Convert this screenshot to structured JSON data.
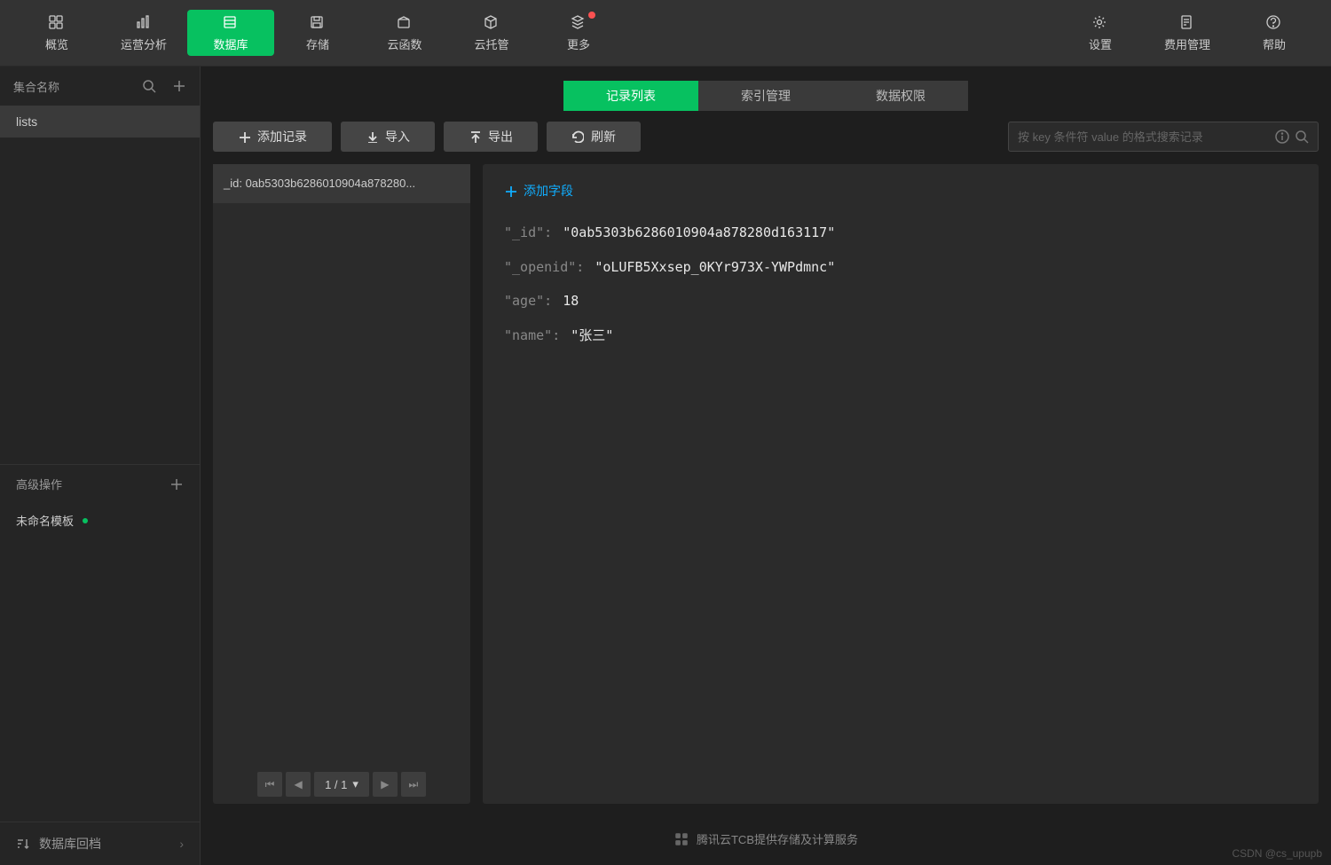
{
  "topnav": {
    "left": [
      {
        "key": "overview",
        "label": "概览",
        "icon": "grid-icon"
      },
      {
        "key": "analytics",
        "label": "运营分析",
        "icon": "bar-chart-icon"
      },
      {
        "key": "database",
        "label": "数据库",
        "icon": "database-icon",
        "active": true
      },
      {
        "key": "storage",
        "label": "存储",
        "icon": "save-icon"
      },
      {
        "key": "cloudfn",
        "label": "云函数",
        "icon": "box-icon"
      },
      {
        "key": "cloudrun",
        "label": "云托管",
        "icon": "cube-icon"
      },
      {
        "key": "more",
        "label": "更多",
        "icon": "layers-icon",
        "notif": true
      }
    ],
    "right": [
      {
        "key": "settings",
        "label": "设置",
        "icon": "gear-icon"
      },
      {
        "key": "billing",
        "label": "费用管理",
        "icon": "receipt-icon"
      },
      {
        "key": "help",
        "label": "帮助",
        "icon": "help-icon"
      }
    ]
  },
  "sidebar": {
    "header": "集合名称",
    "collections": [
      "lists"
    ],
    "advanced": {
      "header": "高级操作",
      "templates": [
        "未命名模板"
      ]
    },
    "footer": "数据库回档"
  },
  "tabs": [
    {
      "label": "记录列表",
      "active": true
    },
    {
      "label": "索引管理"
    },
    {
      "label": "数据权限"
    }
  ],
  "toolbar": {
    "add": "添加记录",
    "import": "导入",
    "export": "导出",
    "refresh": "刷新",
    "searchPlaceholder": "按 key 条件符 value 的格式搜索记录"
  },
  "records": {
    "items": [
      {
        "id_label": "_id: 0ab5303b6286010904a878280..."
      }
    ],
    "pagination": {
      "text": "1 / 1"
    }
  },
  "detail": {
    "addField": "添加字段",
    "fields": [
      {
        "key": "\"_id\"",
        "value": "\"0ab5303b6286010904a878280d163117\"",
        "type": "str"
      },
      {
        "key": "\"_openid\"",
        "value": "\"oLUFB5Xxsep_0KYr973X-YWPdmnc\"",
        "type": "str"
      },
      {
        "key": "\"age\"",
        "value": "18",
        "type": "num"
      },
      {
        "key": "\"name\"",
        "value": "\"张三\"",
        "type": "str"
      }
    ]
  },
  "footer": {
    "text": "腾讯云TCB提供存储及计算服务"
  },
  "watermark": "CSDN @cs_upupb"
}
